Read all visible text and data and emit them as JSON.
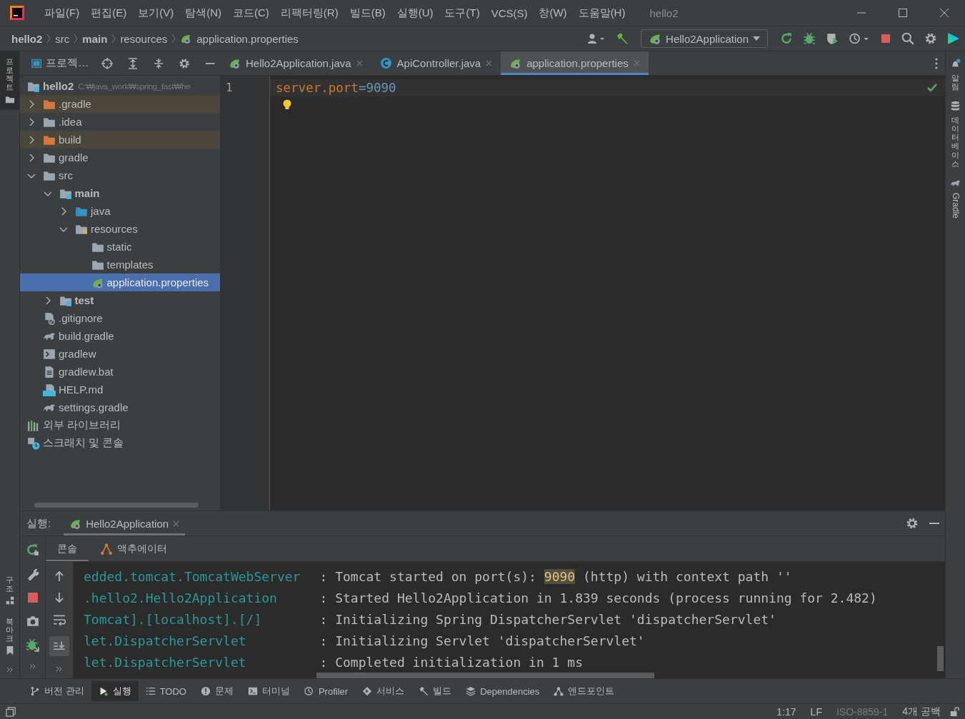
{
  "menu_bar": {
    "items": [
      "파일(F)",
      "편집(E)",
      "보기(V)",
      "탐색(N)",
      "코드(C)",
      "리팩터링(R)",
      "빌드(B)",
      "실행(U)",
      "도구(T)",
      "VCS(S)",
      "창(W)",
      "도움말(H)"
    ],
    "title": "hello2"
  },
  "breadcrumbs": [
    {
      "label": "hello2",
      "bold": true,
      "kind": "text"
    },
    {
      "label": "src",
      "bold": false,
      "kind": "text"
    },
    {
      "label": "main",
      "bold": true,
      "kind": "text"
    },
    {
      "label": "resources",
      "bold": false,
      "kind": "text"
    },
    {
      "label": "application.properties",
      "bold": false,
      "kind": "spring"
    }
  ],
  "run_config": "Hello2Application",
  "left_strip": {
    "top": [
      {
        "label": "프로젝트",
        "selected": true,
        "kind": "project"
      }
    ],
    "bottom": [
      {
        "label": "구조",
        "selected": false,
        "kind": "structure"
      },
      {
        "label": "북마크",
        "selected": false,
        "kind": "bookmarks"
      }
    ]
  },
  "right_strip": [
    {
      "label": "알림",
      "rotated": false,
      "kind": "notifications"
    },
    {
      "label": "데이터베이스",
      "rotated": false,
      "kind": "database"
    },
    {
      "label": "Gradle",
      "rotated": true,
      "kind": "gradle"
    }
  ],
  "project_panel": {
    "title": "프로젝…",
    "tree": [
      {
        "label": "hello2",
        "path": "C:₩java_work₩spring_fast₩he",
        "kind": "module",
        "selected": false,
        "children": [
          {
            "label": ".gradle",
            "kind": "excluded",
            "expanded": false,
            "selected": false
          },
          {
            "label": ".idea",
            "kind": "folder",
            "expanded": false,
            "selected": false
          },
          {
            "label": "build",
            "kind": "excluded",
            "expanded": false,
            "selected": false
          },
          {
            "label": "gradle",
            "kind": "folder",
            "expanded": false,
            "selected": false
          },
          {
            "label": "src",
            "kind": "folder",
            "expanded": true,
            "selected": false,
            "children": [
              {
                "label": "main",
                "kind": "module",
                "expanded": true,
                "selected": false,
                "children": [
                  {
                    "label": "java",
                    "kind": "source",
                    "expanded": false,
                    "selected": false
                  },
                  {
                    "label": "resources",
                    "kind": "resources",
                    "expanded": true,
                    "selected": false,
                    "children": [
                      {
                        "label": "static",
                        "kind": "folder",
                        "selected": false
                      },
                      {
                        "label": "templates",
                        "kind": "folder",
                        "selected": false
                      },
                      {
                        "label": "application.properties",
                        "kind": "spring",
                        "selected": true
                      }
                    ]
                  }
                ]
              },
              {
                "label": "test",
                "kind": "module",
                "expanded": false,
                "selected": false
              }
            ]
          },
          {
            "label": ".gitignore",
            "kind": "ignore",
            "selected": false
          },
          {
            "label": "build.gradle",
            "kind": "gradle",
            "selected": false
          },
          {
            "label": "gradlew",
            "kind": "shell",
            "selected": false
          },
          {
            "label": "gradlew.bat",
            "kind": "textfile",
            "selected": false
          },
          {
            "label": "HELP.md",
            "kind": "md",
            "selected": false
          },
          {
            "label": "settings.gradle",
            "kind": "gradle",
            "selected": false
          }
        ]
      },
      {
        "label": "외부 라이브러리",
        "kind": "libraries",
        "selected": false
      },
      {
        "label": "스크래치 및 콘솔",
        "kind": "scratches",
        "selected": false
      }
    ]
  },
  "editor": {
    "tabs": [
      {
        "label": "Hello2Application.java",
        "kind": "spring-class",
        "selected": false
      },
      {
        "label": "ApiController.java",
        "kind": "class",
        "selected": false
      },
      {
        "label": "application.properties",
        "kind": "spring",
        "selected": true
      }
    ],
    "lines": [
      {
        "number": "1",
        "key": "server.port",
        "separator": "=",
        "value": "9090"
      }
    ]
  },
  "run_panel": {
    "label": "실행:",
    "tabs": [
      {
        "label": "Hello2Application",
        "selected": true
      }
    ],
    "subtabs": [
      {
        "label": "콘솔",
        "kind": "console",
        "selected": true
      },
      {
        "label": "액추에이터",
        "kind": "actuator",
        "selected": false
      }
    ],
    "console": [
      {
        "logger": "edded.tomcat.TomcatWebServer",
        "segments": [
          {
            "text": ": Tomcat started on port(s): ",
            "highlighted": false
          },
          {
            "text": "9090",
            "highlighted": true
          },
          {
            "text": " (http) with context path ''",
            "highlighted": false
          }
        ]
      },
      {
        "logger": ".hello2.Hello2Application",
        "segments": [
          {
            "text": ": Started Hello2Application in 1.839 seconds (process running for 2.482)",
            "highlighted": false
          }
        ]
      },
      {
        "logger": "Tomcat].[localhost].[/]",
        "segments": [
          {
            "text": ": Initializing Spring DispatcherServlet 'dispatcherServlet'",
            "highlighted": false
          }
        ]
      },
      {
        "logger": "let.DispatcherServlet",
        "segments": [
          {
            "text": ": Initializing Servlet 'dispatcherServlet'",
            "highlighted": false
          }
        ]
      },
      {
        "logger": "let.DispatcherServlet",
        "segments": [
          {
            "text": ": Completed initialization in 1 ms",
            "highlighted": false
          }
        ]
      }
    ]
  },
  "tool_bar": [
    {
      "label": "버전 관리",
      "kind": "vcs",
      "selected": false
    },
    {
      "label": "실행",
      "kind": "run",
      "selected": true
    },
    {
      "label": "TODO",
      "kind": "todo",
      "selected": false
    },
    {
      "label": "문제",
      "kind": "problems",
      "selected": false
    },
    {
      "label": "터미널",
      "kind": "terminal",
      "selected": false
    },
    {
      "label": "Profiler",
      "kind": "profiler",
      "selected": false
    },
    {
      "label": "서비스",
      "kind": "services",
      "selected": false
    },
    {
      "label": "빌드",
      "kind": "build",
      "selected": false
    },
    {
      "label": "Dependencies",
      "kind": "dependencies",
      "selected": false
    },
    {
      "label": "엔드포인트",
      "kind": "endpoints",
      "selected": false
    }
  ],
  "status_bar": [
    {
      "label": "1:17",
      "disabled": false
    },
    {
      "label": "LF",
      "disabled": false
    },
    {
      "label": "ISO-8859-1",
      "disabled": true
    },
    {
      "label": "4개 공백",
      "disabled": false
    }
  ]
}
